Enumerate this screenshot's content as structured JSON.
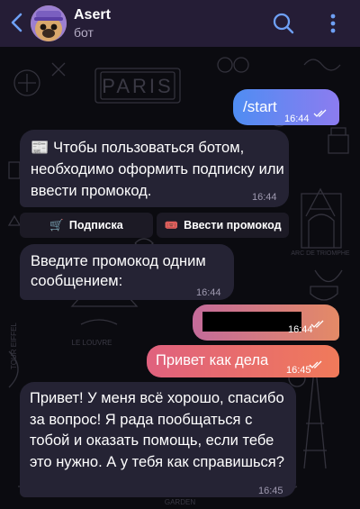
{
  "header": {
    "title": "Asert",
    "subtitle": "бот"
  },
  "messages": {
    "start": {
      "text": "/start",
      "time": "16:44"
    },
    "bot1": {
      "text": "📰 Чтобы пользоваться ботом, необходимо оформить подписку или ввести промокод.",
      "time": "16:44"
    },
    "keyboard": {
      "subscribe": {
        "icon": "🛒",
        "label": "Подписка"
      },
      "promo": {
        "icon": "🎟️",
        "label": "Ввести промокод"
      }
    },
    "bot2": {
      "text": "Введите промокод одним сообщением:",
      "time": "16:44"
    },
    "redacted": {
      "time": "16:44"
    },
    "hello": {
      "text": "Привет как дела",
      "time": "16:45"
    },
    "bot3": {
      "text": "Привет! У меня всё хорошо, спасибо за вопрос! Я рада пообщаться с тобой и оказать помощь, если тебе это нужно. А у тебя как справишься?",
      "time": "16:45"
    }
  },
  "background": {
    "labels": {
      "paris": "PARIS",
      "arc": "ARC DE TRIOMPHE",
      "louvre": "LE LOUVRE",
      "tour": "TOUR EIFFEL",
      "garden": "GARDEN"
    }
  },
  "colors": {
    "header_bg": "#251d36",
    "accent": "#6ea0f5",
    "incoming_bubble": "#252334"
  }
}
